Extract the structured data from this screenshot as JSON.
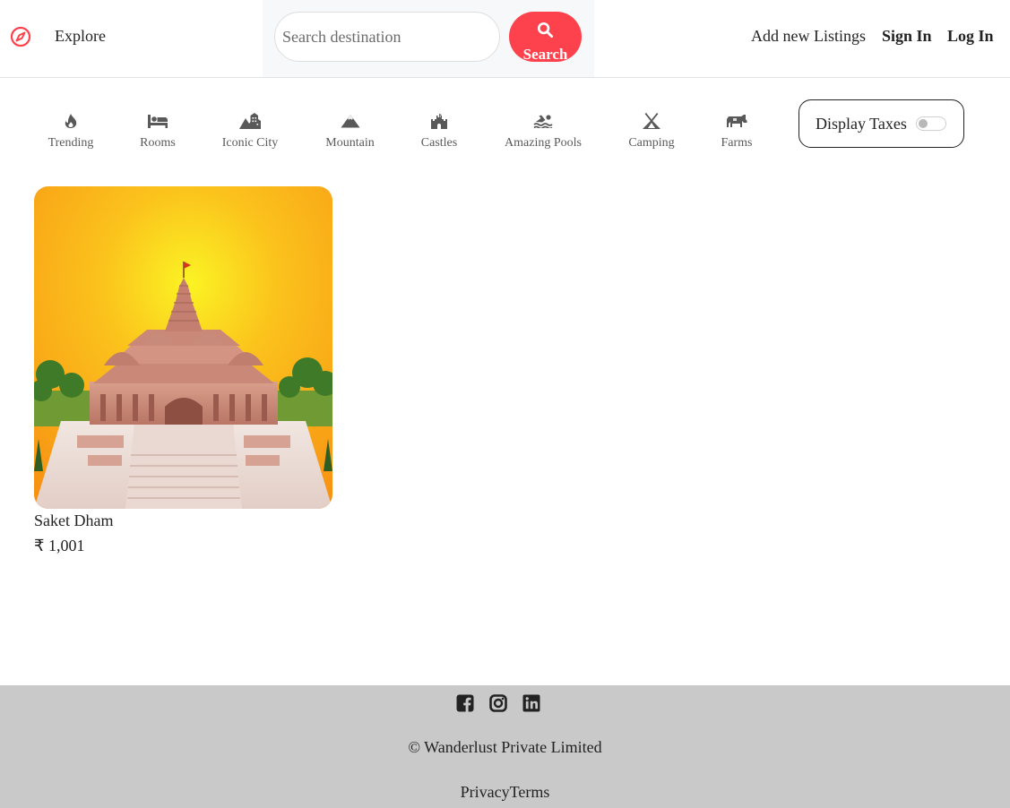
{
  "nav": {
    "brand_icon": "compass-icon",
    "explore_label": "Explore",
    "search_placeholder": "Search destination",
    "search_value": "",
    "search_button_label": "Search",
    "add_listing_label": "Add new Listings",
    "sign_in_label": "Sign In",
    "log_in_label": "Log In",
    "accent_color": "#fe424d"
  },
  "filters": [
    {
      "label": "Trending",
      "icon": "fire-icon"
    },
    {
      "label": "Rooms",
      "icon": "bed-icon"
    },
    {
      "label": "Iconic City",
      "icon": "city-icon"
    },
    {
      "label": "Mountain",
      "icon": "mountain-icon"
    },
    {
      "label": "Castles",
      "icon": "castle-icon"
    },
    {
      "label": "Amazing Pools",
      "icon": "swimming-pool-icon"
    },
    {
      "label": "Camping",
      "icon": "tent-icon"
    },
    {
      "label": "Farms",
      "icon": "cow-icon"
    }
  ],
  "tax_toggle": {
    "label": "Display Taxes",
    "enabled": false
  },
  "listings": [
    {
      "title": "Saket Dham",
      "price": "₹ 1,001"
    }
  ],
  "footer": {
    "social": [
      "facebook-icon",
      "instagram-icon",
      "linkedin-icon"
    ],
    "copyright": "© Wanderlust Private Limited",
    "privacy_label": "Privacy",
    "terms_label": "Terms",
    "background": "#c9c9c9"
  }
}
